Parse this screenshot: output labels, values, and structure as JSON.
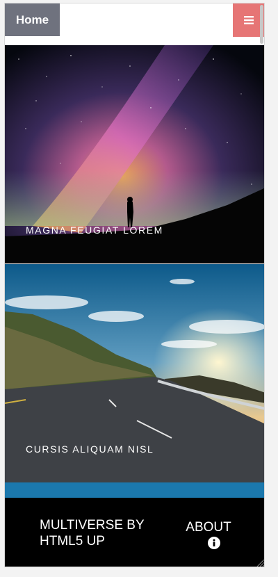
{
  "header": {
    "home_label": "Home",
    "menu_icon": "menu-icon"
  },
  "tiles": [
    {
      "caption": "MAGNA FEUGIAT LOREM",
      "image": "milky-way-silhouette-photo"
    },
    {
      "caption": "CURSIS ALIQUAM NISL",
      "image": "coastal-road-sunset-photo"
    }
  ],
  "footer": {
    "title": "MULTIVERSE BY HTML5 UP",
    "about_label": "ABOUT",
    "info_icon": "info-icon"
  },
  "colors": {
    "home_bg": "#6f727e",
    "menu_bg": "#e67575",
    "accent_bar": "#1b78ad",
    "footer_bg": "#000000"
  }
}
